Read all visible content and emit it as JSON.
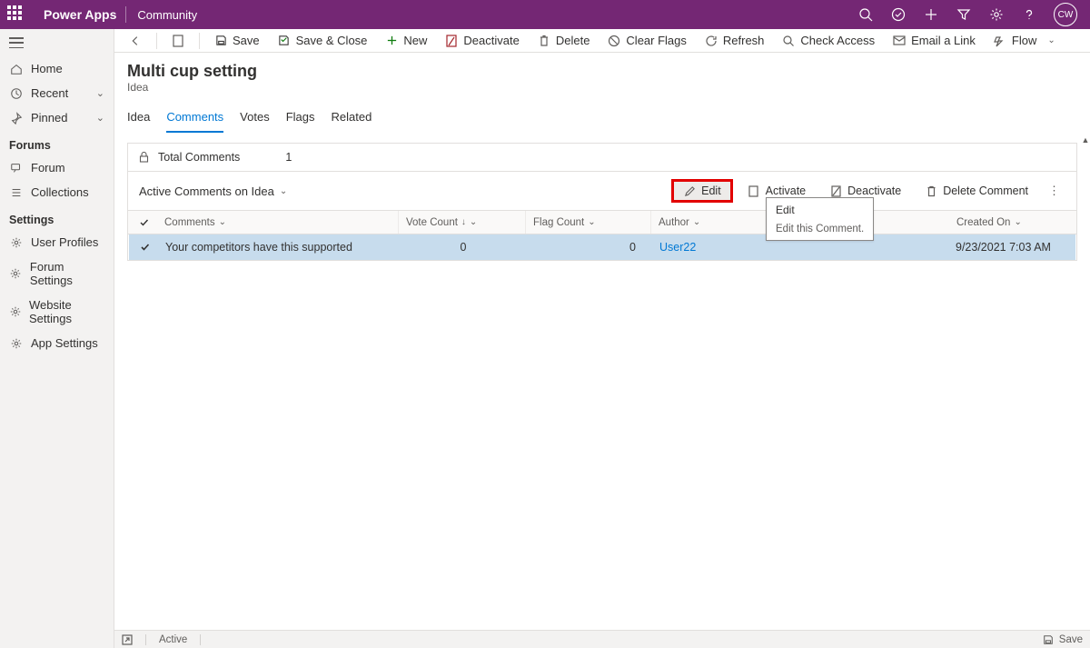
{
  "topbar": {
    "brand": "Power Apps",
    "community": "Community",
    "avatar": "CW"
  },
  "sidebar": {
    "home": "Home",
    "recent": "Recent",
    "pinned": "Pinned",
    "section_forums": "Forums",
    "forum": "Forum",
    "collections": "Collections",
    "section_settings": "Settings",
    "user_profiles": "User Profiles",
    "forum_settings": "Forum Settings",
    "website_settings": "Website Settings",
    "app_settings": "App Settings"
  },
  "cmdbar": {
    "save": "Save",
    "save_close": "Save & Close",
    "new": "New",
    "deactivate": "Deactivate",
    "delete": "Delete",
    "clear_flags": "Clear Flags",
    "refresh": "Refresh",
    "check_access": "Check Access",
    "email_link": "Email a Link",
    "flow": "Flow"
  },
  "page": {
    "title": "Multi cup setting",
    "subtitle": "Idea"
  },
  "tabs": {
    "idea": "Idea",
    "comments": "Comments",
    "votes": "Votes",
    "flags": "Flags",
    "related": "Related"
  },
  "card": {
    "total_label": "Total Comments",
    "total_value": "1",
    "view_title": "Active Comments on Idea"
  },
  "toolbar": {
    "edit": "Edit",
    "activate": "Activate",
    "deactivate": "Deactivate",
    "delete_comment": "Delete Comment"
  },
  "columns": {
    "comments": "Comments",
    "vote_count": "Vote Count",
    "flag_count": "Flag Count",
    "author": "Author",
    "created_on": "Created On"
  },
  "row": {
    "comment": "Your competitors have this supported",
    "vote": "0",
    "flag": "0",
    "author": "User22",
    "created": "9/23/2021 7:03 AM"
  },
  "tooltip": {
    "title": "Edit",
    "desc": "Edit this Comment."
  },
  "statusbar": {
    "active": "Active",
    "save": "Save"
  }
}
